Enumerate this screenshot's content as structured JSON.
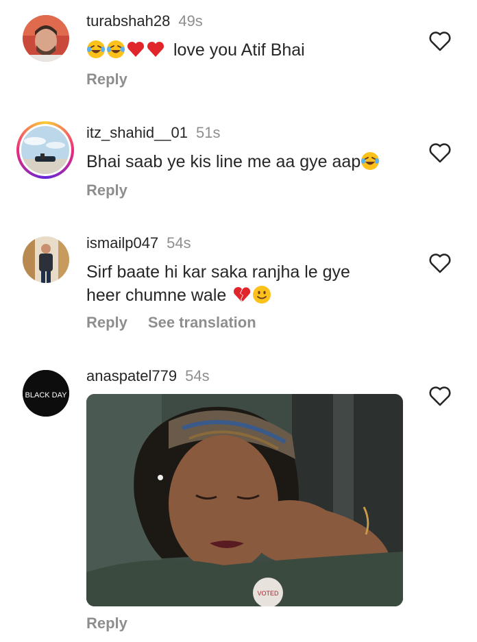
{
  "comments": [
    {
      "username": "turabshah28",
      "time": "49s",
      "text": "love you Atif Bhai",
      "emoji_prefix": [
        "laughing-tears",
        "laughing-tears",
        "red-heart",
        "red-heart"
      ],
      "reply": "Reply"
    },
    {
      "username": "itz_shahid__01",
      "time": "51s",
      "text": "Bhai saab ye kis line me aa gye aap",
      "emoji_suffix": [
        "laughing-tears"
      ],
      "reply": "Reply"
    },
    {
      "username": "ismailp047",
      "time": "54s",
      "text_line1": "Sirf baate hi kar saka ranjha le gye",
      "text_line2": "heer chumne wale",
      "emoji_suffix": [
        "broken-heart",
        "slight-smile"
      ],
      "reply": "Reply",
      "see_translation": "See translation"
    },
    {
      "username": "anaspatel779",
      "time": "54s",
      "avatar_text": "BLACK DAY",
      "gif_badge": "VOTED",
      "reply": "Reply"
    }
  ],
  "colors": {
    "text": "#262626",
    "secondary": "#8e8e8e",
    "heart_outline": "#262626"
  },
  "icons": {
    "like": "heart-outline-icon"
  }
}
